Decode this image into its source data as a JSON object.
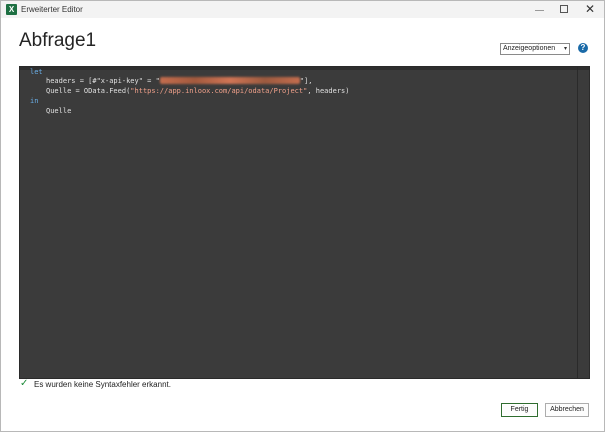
{
  "window": {
    "app_icon_letter": "X",
    "title": "Erweiterter Editor",
    "close_symbol": "✕"
  },
  "page": {
    "title": "Abfrage1"
  },
  "toolbar": {
    "options_label": "Anzeigeoptionen",
    "options_arrow": "▾",
    "help_symbol": "?"
  },
  "code": {
    "kw_let": "let",
    "line_headers_prefix": "headers = [#\"x-api-key\" = \"",
    "line_headers_suffix": "\"],",
    "line_quelle_prefix": "Quelle = OData.Feed(",
    "line_quelle_url": "\"https://app.inloox.com/api/odata/Project\"",
    "line_quelle_suffix": ", headers)",
    "kw_in": "in",
    "line_result": "Quelle"
  },
  "status": {
    "icon": "check-icon",
    "check_symbol": "✓",
    "text": "Es wurden keine Syntaxfehler erkannt."
  },
  "buttons": {
    "ok_label": "Fertig",
    "cancel_label": "Abbrechen"
  },
  "colors": {
    "editor_bg": "#3b3b3b",
    "keyword": "#6aaee6",
    "string": "#f0a08a",
    "success": "#1e8b3a",
    "excel_green": "#1d6f42"
  }
}
